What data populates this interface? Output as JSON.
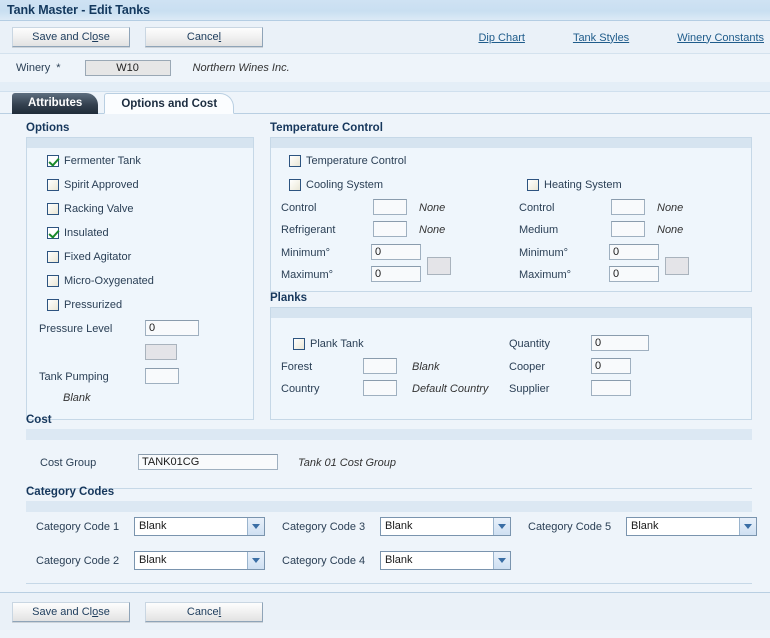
{
  "window": {
    "title": "Tank Master - Edit Tanks"
  },
  "toolbar": {
    "save_label_pre": "Save and Cl",
    "save_label_acc": "o",
    "save_label_post": "se",
    "save_label": "Save and Close",
    "cancel_label_pre": "Cance",
    "cancel_label_acc": "l",
    "cancel_label": "Cancel",
    "links": [
      {
        "label": "Dip Chart"
      },
      {
        "label": "Tank Styles"
      },
      {
        "label": "Winery Constants"
      }
    ]
  },
  "winery": {
    "label": "Winery",
    "required_marker": "*",
    "value": "W10",
    "description": "Northern Wines Inc."
  },
  "tabs": [
    {
      "label": "Attributes",
      "active": false
    },
    {
      "label": "Options and Cost",
      "active": true
    }
  ],
  "options": {
    "title": "Options",
    "checkboxes": [
      {
        "label": "Fermenter Tank",
        "checked": true
      },
      {
        "label": "Spirit Approved",
        "checked": false
      },
      {
        "label": "Racking Valve",
        "checked": false
      },
      {
        "label": "Insulated",
        "checked": true
      },
      {
        "label": "Fixed Agitator",
        "checked": false
      },
      {
        "label": "Micro-Oxygenated",
        "checked": false
      },
      {
        "label": "Pressurized",
        "checked": false
      }
    ],
    "pressure_level_label": "Pressure Level",
    "pressure_level_value": "0",
    "pressure_uom_value": "",
    "tank_pumping_label": "Tank Pumping",
    "tank_pumping_value": "",
    "tank_pumping_desc": "Blank"
  },
  "temperature_control": {
    "title": "Temperature Control",
    "enable_label": "Temperature Control",
    "enable_checked": false,
    "cooling": {
      "title": "Cooling System",
      "checked": false,
      "control_label": "Control",
      "control_value": "",
      "control_desc": "None",
      "refrigerant_label": "Refrigerant",
      "refrigerant_value": "",
      "refrigerant_desc": "None",
      "minimum_label": "Minimum°",
      "minimum_value": "0",
      "maximum_label": "Maximum°",
      "maximum_value": "0",
      "uom_value": ""
    },
    "heating": {
      "title": "Heating System",
      "checked": false,
      "control_label": "Control",
      "control_value": "",
      "control_desc": "None",
      "medium_label": "Medium",
      "medium_value": "",
      "medium_desc": "None",
      "minimum_label": "Minimum°",
      "minimum_value": "0",
      "maximum_label": "Maximum°",
      "maximum_value": "0",
      "uom_value": ""
    }
  },
  "planks": {
    "title": "Planks",
    "plank_tank_label": "Plank Tank",
    "plank_tank_checked": false,
    "forest_label": "Forest",
    "forest_value": "",
    "forest_desc": "Blank",
    "country_label": "Country",
    "country_value": "",
    "country_desc": "Default Country",
    "quantity_label": "Quantity",
    "quantity_value": "0",
    "cooper_label": "Cooper",
    "cooper_value": "0",
    "supplier_label": "Supplier",
    "supplier_value": ""
  },
  "cost": {
    "title": "Cost",
    "cost_group_label": "Cost Group",
    "cost_group_value": "TANK01CG",
    "cost_group_desc": "Tank 01 Cost Group"
  },
  "category_codes": {
    "title": "Category Codes",
    "items": [
      {
        "label": "Category Code 1",
        "value": "Blank"
      },
      {
        "label": "Category Code 2",
        "value": "Blank"
      },
      {
        "label": "Category Code 3",
        "value": "Blank"
      },
      {
        "label": "Category Code 4",
        "value": "Blank"
      },
      {
        "label": "Category Code 5",
        "value": "Blank"
      }
    ]
  },
  "bottom_toolbar": {
    "save_label_pre": "Save and Cl",
    "save_label_acc": "o",
    "save_label_post": "se",
    "cancel_label_pre": "Cance",
    "cancel_label_acc": "l"
  },
  "colors": {
    "title_bar": "#cfe2f3",
    "page_bg": "#eef4fa",
    "section_strip": "#d6e4f0",
    "link": "#1f5c8b",
    "check_green": "#1a8a2a",
    "tab_active_bg": "#fbfdff",
    "tab_inactive_bg": "#34414f"
  }
}
